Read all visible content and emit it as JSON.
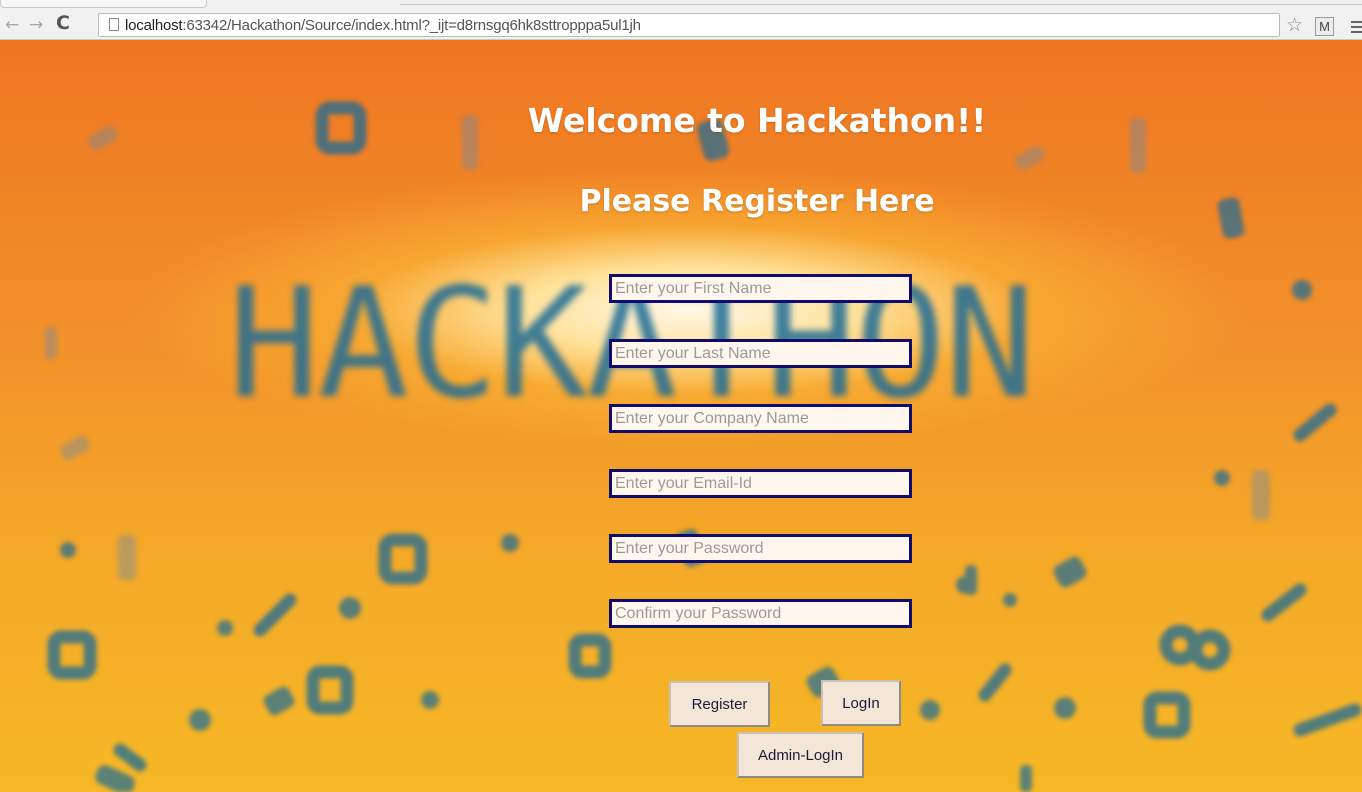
{
  "browser": {
    "back_icon": "arrow-left-icon",
    "forward_icon": "arrow-right-icon",
    "reload_icon": "reload-icon",
    "url_host": "localhost",
    "url_rest": ":63342/Hackathon/Source/index.html?_ijt=d8rnsgq6hk8sttropppa5ul1jh",
    "bookmark_icon": "star-icon",
    "extension_label": "M",
    "menu_icon": "menu-icon"
  },
  "page": {
    "heading": "Welcome to Hackathon!!",
    "subheading": "Please Register Here",
    "background_word": "HACKATHON",
    "fields": {
      "first_name": {
        "placeholder": "Enter your First Name",
        "value": ""
      },
      "last_name": {
        "placeholder": "Enter your Last Name",
        "value": ""
      },
      "company": {
        "placeholder": "Enter your Company Name",
        "value": ""
      },
      "email": {
        "placeholder": "Enter your Email-Id",
        "value": ""
      },
      "password": {
        "placeholder": "Enter your Password",
        "value": ""
      },
      "confirm_password": {
        "placeholder": "Confirm your Password",
        "value": ""
      }
    },
    "buttons": {
      "register": "Register",
      "login": "LogIn",
      "admin_login": "Admin-LogIn"
    }
  },
  "colors": {
    "field_border": "#100c6e",
    "background_orange": "#ef7622",
    "background_yellow": "#f6b826",
    "logo_blue": "#1f6c96"
  }
}
